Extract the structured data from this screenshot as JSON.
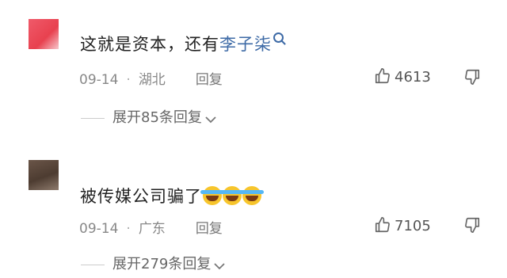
{
  "comments": [
    {
      "text_before": "这就是资本，还有",
      "highlight": "李子柒",
      "date": "09-14",
      "location": "湖北",
      "reply_label": "回复",
      "likes": "4613",
      "expand_label": "展开85条回复",
      "avatar_color": "#e8414f"
    },
    {
      "text_before": "被传媒公司骗了",
      "emojis": [
        "laugh-cry-emoji",
        "laugh-cry-emoji",
        "laugh-cry-emoji"
      ],
      "date": "09-14",
      "location": "广东",
      "reply_label": "回复",
      "likes": "7105",
      "expand_label": "展开279条回复",
      "avatar_color": "#4d3c31"
    }
  ],
  "separator": "·",
  "colors": {
    "link": "#3d6aa6",
    "meta": "#888888",
    "text": "#222222"
  },
  "icons": [
    "thumbs-up-icon",
    "thumbs-down-icon",
    "chevron-down-icon",
    "search-icon"
  ]
}
